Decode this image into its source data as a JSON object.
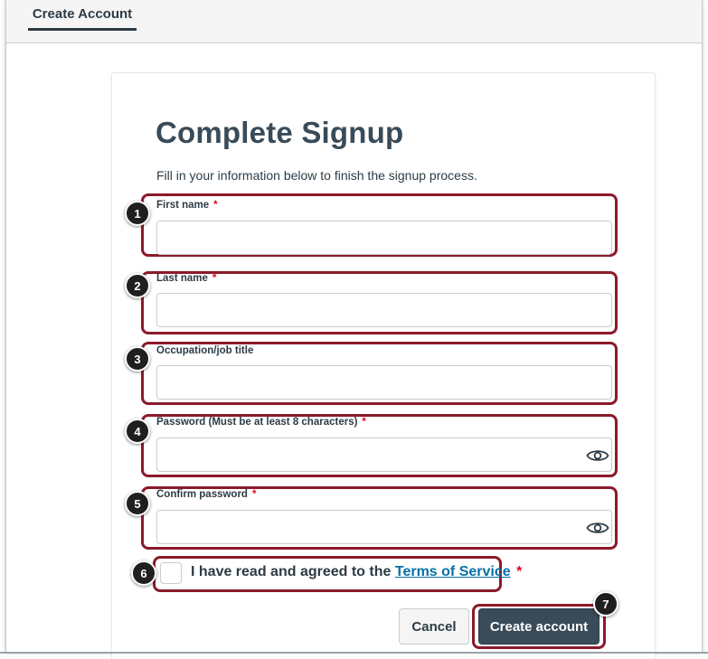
{
  "header": {
    "tab_label": "Create Account"
  },
  "form": {
    "title": "Complete Signup",
    "subtitle": "Fill in your information below to finish the signup process.",
    "required_marker": "*",
    "fields": [
      {
        "label": "First name",
        "required": true,
        "value": "",
        "placeholder": ""
      },
      {
        "label": "Last name",
        "required": true,
        "value": "",
        "placeholder": ""
      },
      {
        "label": "Occupation/job title",
        "required": false,
        "value": "",
        "placeholder": ""
      },
      {
        "label": "Password (Must be at least 8 characters)",
        "required": true,
        "value": "",
        "placeholder": "",
        "icon": "eye-icon"
      },
      {
        "label": "Confirm password",
        "required": true,
        "value": "",
        "placeholder": "",
        "icon": "eye-icon"
      }
    ],
    "terms": {
      "checked": false,
      "text": "I have read and agreed to the",
      "link_text": "Terms of Service"
    },
    "cancel_label": "Cancel",
    "create_label": "Create account"
  },
  "callouts": [
    "1",
    "2",
    "3",
    "4",
    "5",
    "6",
    "7"
  ],
  "colors": {
    "callout_outline": "#8b1a2b",
    "primary_button": "#394b58",
    "link": "#0770a3",
    "required": "#e0061f"
  }
}
